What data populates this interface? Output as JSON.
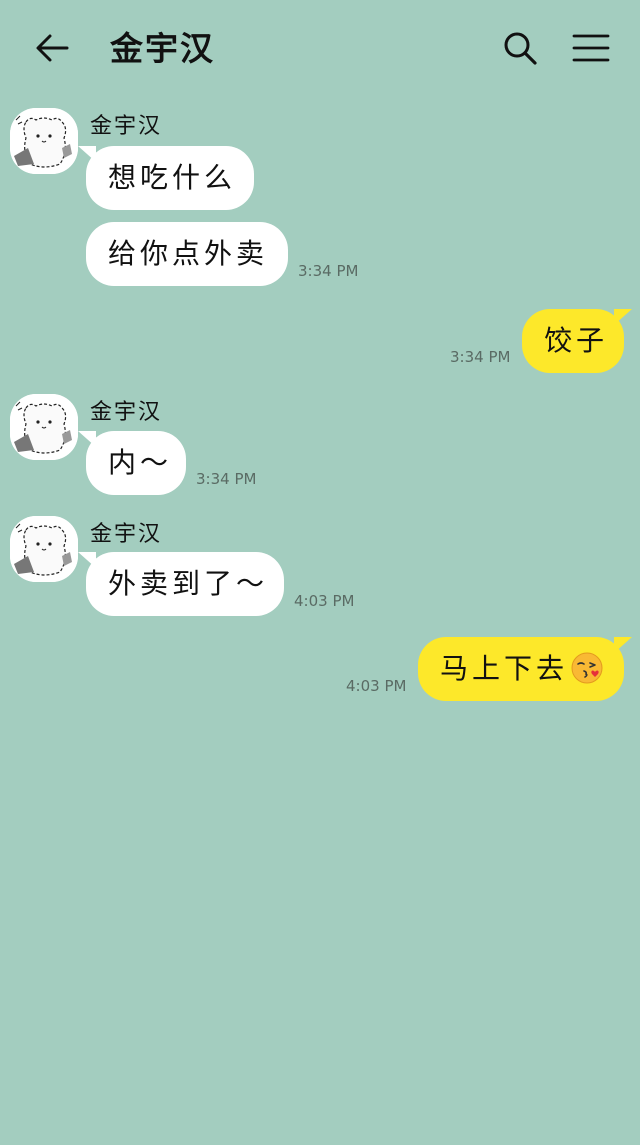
{
  "header": {
    "title": "金宇汉",
    "back_icon": "back-arrow-icon",
    "search_icon": "search-icon",
    "menu_icon": "menu-icon"
  },
  "colors": {
    "background": "#a3cdbf",
    "incoming_bubble": "#ffffff",
    "outgoing_bubble": "#fde82a"
  },
  "messages": [
    {
      "sender": "金宇汉",
      "text": "想吃什么"
    },
    {
      "text": "给你点外卖",
      "time": "3:34 PM"
    },
    {
      "text": "饺子",
      "time": "3:34 PM"
    },
    {
      "sender": "金宇汉",
      "text": "内～",
      "time": "3:34 PM"
    },
    {
      "sender": "金宇汉",
      "text": "外卖到了～",
      "time": "4:03 PM"
    },
    {
      "text": "马上下去",
      "emoji": "kissing-face-emoji",
      "time": "4:03 PM"
    }
  ]
}
